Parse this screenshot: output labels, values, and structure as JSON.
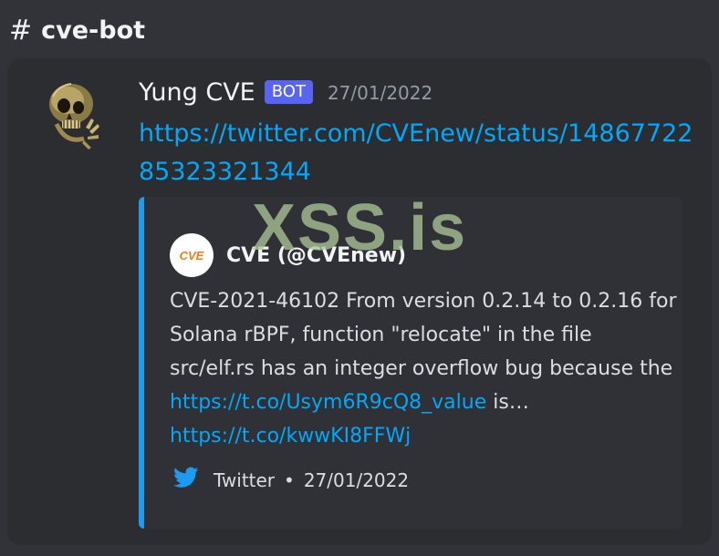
{
  "channel": {
    "name": "cve-bot",
    "icon": "hash-icon"
  },
  "message": {
    "author": "Yung CVE",
    "bot_tag": "BOT",
    "timestamp": "27/01/2022",
    "avatar_icon": "skull-avatar",
    "link": "https://twitter.com/CVEnew/status/1486772285323321344",
    "embed": {
      "accent_color": "#1d9bf0",
      "author_icon": "cve-logo",
      "author_logo_text": "CVE",
      "author_name": "CVE (@CVEnew)",
      "description_text_1": "CVE-2021-46102 From version 0.2.14 to 0.2.16 for Solana rBPF, function \"relocate\" in the file src/elf.rs has an integer overflow bug because the ",
      "description_link_1": "https://t.co/Usym6R9cQ8_value",
      "description_text_2": " is… ",
      "description_link_2": "https://t.co/kwwKI8FFWj",
      "footer_icon": "twitter-bird-icon",
      "footer_source": "Twitter",
      "footer_separator": "•",
      "footer_timestamp": "27/01/2022"
    }
  },
  "watermark": "XSS.is",
  "colors": {
    "background": "#313338",
    "message_bg": "#2b2d31",
    "link": "#00a8fc",
    "bot_tag": "#5865f2",
    "twitter": "#1d9bf0"
  }
}
